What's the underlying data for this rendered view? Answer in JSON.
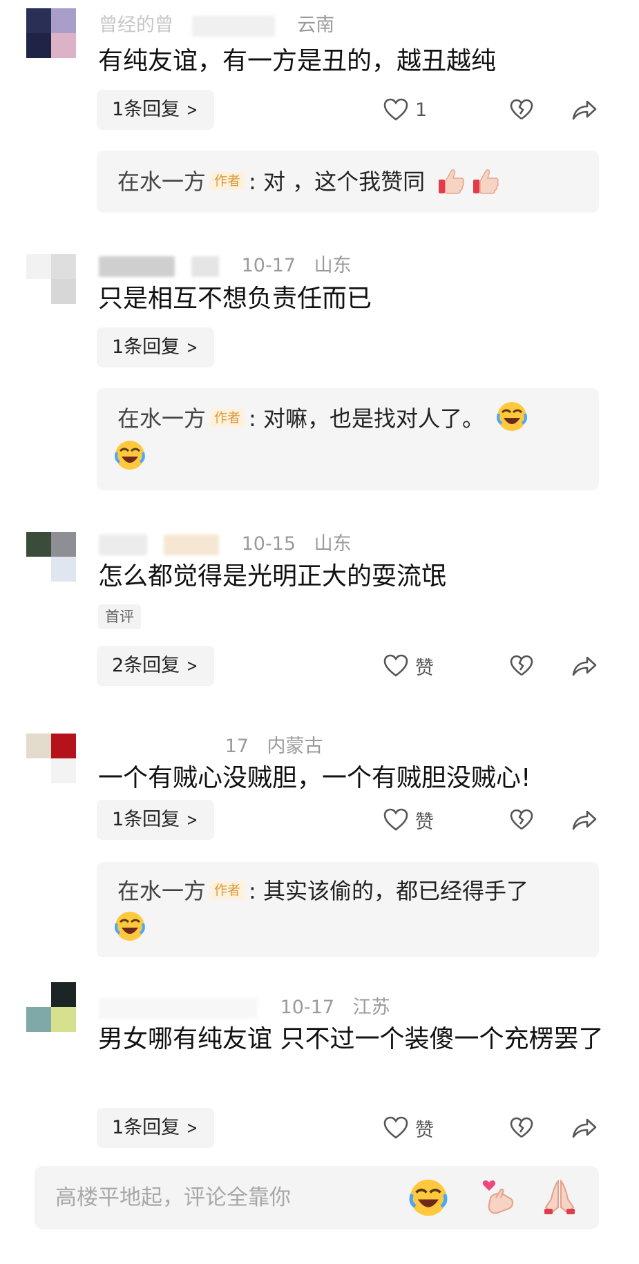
{
  "comments": [
    {
      "meta": {
        "name": "曾经的曾",
        "date": "",
        "location": "云南"
      },
      "text": "有纯友谊，有一方是丑的，越丑越纯",
      "reply_label": "1条回复",
      "like_label": "1",
      "author_reply": {
        "name": "在水一方",
        "badge": "作者",
        "text": ": 对 ，这个我赞同"
      }
    },
    {
      "meta": {
        "name": "",
        "date": "10-17",
        "location": "山东"
      },
      "text": "只是相互不想负责任而已",
      "reply_label": "1条回复",
      "author_reply": {
        "name": "在水一方",
        "badge": "作者",
        "text": ": 对嘛，也是找对人了。"
      }
    },
    {
      "meta": {
        "name": "",
        "date": "10-15",
        "location": "山东"
      },
      "text": "怎么都觉得是光明正大的耍流氓",
      "tag": "首评",
      "reply_label": "2条回复",
      "like_label": "赞"
    },
    {
      "meta": {
        "name": "",
        "date": "17",
        "location": "内蒙古"
      },
      "text": "一个有贼心没贼胆，一个有贼胆没贼心!",
      "reply_label": "1条回复",
      "like_label": "赞",
      "author_reply": {
        "name": "在水一方",
        "badge": "作者",
        "text": ": 其实该偷的，都已经得手了"
      }
    },
    {
      "meta": {
        "name": "",
        "date": "10-17",
        "location": "江苏"
      },
      "text": "男女哪有纯友谊 只不过一个装傻一个充楞罢了",
      "reply_label": "1条回复",
      "like_label": "赞"
    }
  ],
  "input": {
    "placeholder": "高楼平地起，评论全靠你"
  },
  "icons": {
    "like": "heart-outline-icon",
    "dislike": "broken-heart-icon",
    "share": "share-arrow-icon",
    "thumbs_up": "thumbs-up-emoji",
    "laughing": "rolling-laughing-emoji",
    "finger_heart": "finger-heart-emoji",
    "praying": "praying-hands-emoji"
  },
  "colors": {
    "badge_bg": "#fff1dc",
    "badge_text": "#d89a3c",
    "meta_text": "#9a9a9a"
  }
}
